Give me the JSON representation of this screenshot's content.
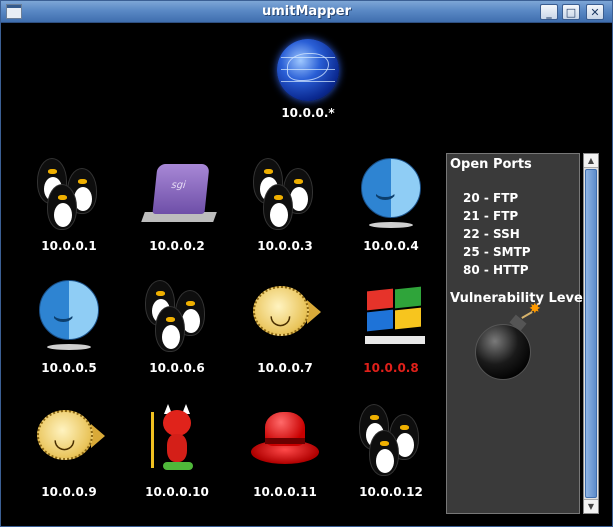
{
  "window": {
    "title": "umitMapper",
    "buttons": {
      "minimize": "_",
      "maximize": "□",
      "close": "✕"
    }
  },
  "map": {
    "root": {
      "label": "10.0.0.*",
      "icon": "globe-icon"
    },
    "hosts": [
      {
        "label": "10.0.0.1",
        "icon": "linux-penguins-icon"
      },
      {
        "label": "10.0.0.2",
        "icon": "sgi-irix-icon"
      },
      {
        "label": "10.0.0.3",
        "icon": "linux-penguins-icon"
      },
      {
        "label": "10.0.0.4",
        "icon": "macos-finder-icon"
      },
      {
        "label": "10.0.0.5",
        "icon": "macos-finder-icon"
      },
      {
        "label": "10.0.0.6",
        "icon": "linux-penguins-icon"
      },
      {
        "label": "10.0.0.7",
        "icon": "openbsd-blowfish-icon"
      },
      {
        "label": "10.0.0.8",
        "icon": "windows-flag-icon",
        "label_color": "#e0201a"
      },
      {
        "label": "10.0.0.9",
        "icon": "openbsd-blowfish-icon"
      },
      {
        "label": "10.0.0.10",
        "icon": "freebsd-daemon-icon"
      },
      {
        "label": "10.0.0.11",
        "icon": "redhat-hat-icon"
      },
      {
        "label": "10.0.0.12",
        "icon": "linux-penguins-icon"
      }
    ]
  },
  "info_panel": {
    "ports_heading": "Open Ports",
    "ports": [
      "20 - FTP",
      "21 - FTP",
      "22 - SSH",
      "25 - SMTP",
      "80 - HTTP"
    ],
    "vulnerability_heading": "Vulnerability Level",
    "vulnerability_icon": "bomb-icon"
  },
  "scrollbar": {
    "up": "▲",
    "down": "▼"
  },
  "colors": {
    "titlebar": "#5a89c5",
    "background": "#000000",
    "label": "#ffffff",
    "vulnerable_label": "#e0201a",
    "panel": "#3a3a3a"
  }
}
